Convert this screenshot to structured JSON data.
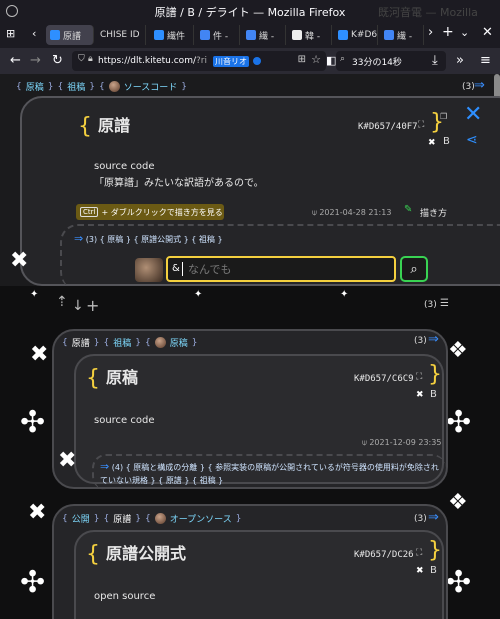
{
  "browser": {
    "window_title": "原譜 / B / デライト — Mozilla Firefox",
    "bg_title": "既河音電 — Mozilla Firefox",
    "tabs": [
      "原譜",
      "CHISE ID",
      "繊件",
      "件 -",
      "繊 -",
      "韓 -",
      "K#D6",
      "繊 -"
    ],
    "url_host": "https://dlt.kitetu.com/",
    "url_rest": "?ri",
    "extension_label": "川音リオ",
    "find_text": "33分の14秒"
  },
  "main": {
    "breadcrumb": [
      "原稿",
      "祖稿",
      "ソースコード"
    ],
    "count": "(3)",
    "title": "原譜",
    "kid": "K#D657/40F7",
    "b_label": "B",
    "body": [
      "source code",
      "「原算譜」みたいな訳語があるので。"
    ],
    "timestamp": "2021-04-28 21:13",
    "write_label": "描き方",
    "hint_key": "Ctrl",
    "hint_text": "+ ダブルクリックで描き方を見る",
    "refs_count": "(3)",
    "refs": [
      "原稿",
      "原譜公開式",
      "祖稿"
    ],
    "search_prefix": "&",
    "search_placeholder": "なんでも"
  },
  "sub_header": {
    "count": "(3)"
  },
  "cards": [
    {
      "breadcrumb": [
        "原譜",
        "祖稿",
        "原稿"
      ],
      "count": "(3)",
      "title": "原稿",
      "kid": "K#D657/C6C9",
      "b_label": "B",
      "body": "source code",
      "timestamp": "2021-12-09 23:35",
      "refs_count": "(4)",
      "refs_line1": [
        "原稿と構成の分離",
        "参照実装の原稿が公開されているが符号器の使用料が免除され"
      ],
      "refs_line2": [
        "ていない規格",
        "原譜",
        "祖稿"
      ]
    },
    {
      "breadcrumb": [
        "公開",
        "原譜",
        "オープンソース"
      ],
      "count": "(3)",
      "title": "原譜公開式",
      "kid": "K#D657/DC26",
      "b_label": "B",
      "body": "open source"
    }
  ],
  "colors": {
    "accent_blue": "#2e8fff",
    "brace_yellow": "#f4d03f",
    "search_border": "#f4d03f",
    "search_button": "#39d353"
  }
}
